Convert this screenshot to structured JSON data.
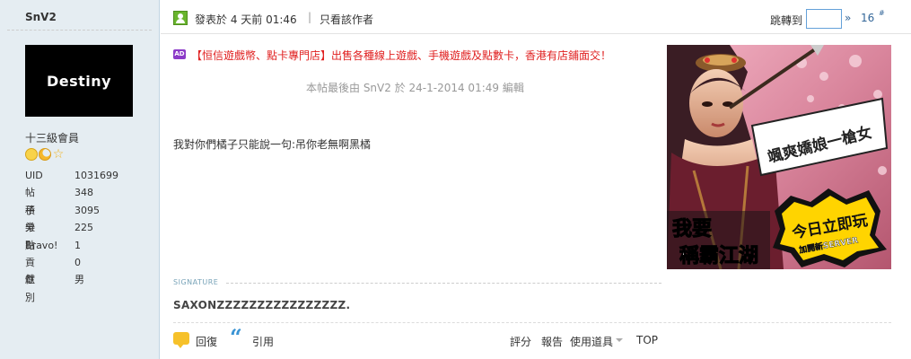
{
  "user": {
    "name": "SnV2",
    "avatar_text": "Destiny",
    "rank": "十三級會員",
    "stats": [
      {
        "label": "UID",
        "value": "1031699"
      },
      {
        "label": "帖子",
        "value": "348"
      },
      {
        "label": "積分",
        "value": "3095"
      },
      {
        "label": "樂點",
        "value": "225"
      },
      {
        "label": "Bravo!",
        "value": "1"
      },
      {
        "label": "貢獻",
        "value": "0"
      },
      {
        "label": "性別",
        "value": "男"
      }
    ]
  },
  "post_header": {
    "post_time": "發表於 4 天前 01:46",
    "separator": "|",
    "only_author": "只看該作者",
    "jump_label": "跳轉到",
    "jump_go": "»",
    "floor": "16",
    "floor_mark": "#"
  },
  "ad": {
    "icon": "AD",
    "text": "【恒信遊戲幣、點卡專門店】出售各種線上遊戲、手機遊戲及點數卡，香港有店鋪面交！"
  },
  "edited_note": "本帖最後由 SnV2 於 24-1-2014 01:49 編輯",
  "body": "我對你們橘子只能說一句:吊你老無啊黑橘",
  "banner": {
    "speech": "颯爽嬌娘一槍女",
    "line1": "我要",
    "line2": "稱霸江湖",
    "badge": "今日立即玩",
    "badge_sub": "加開新SERVER"
  },
  "signature": {
    "label": "SIGNATURE",
    "text": "SAXONZZZZZZZZZZZZZZZZ."
  },
  "actions": {
    "reply": "回復",
    "quote": "引用",
    "rate": "評分",
    "report": "報告",
    "use_item": "使用道具",
    "top": "TOP"
  },
  "colors": {
    "sidebar_bg": "#e5edf2",
    "ad_text": "#e02020",
    "link": "#336699",
    "online_icon": "#69b52d"
  }
}
